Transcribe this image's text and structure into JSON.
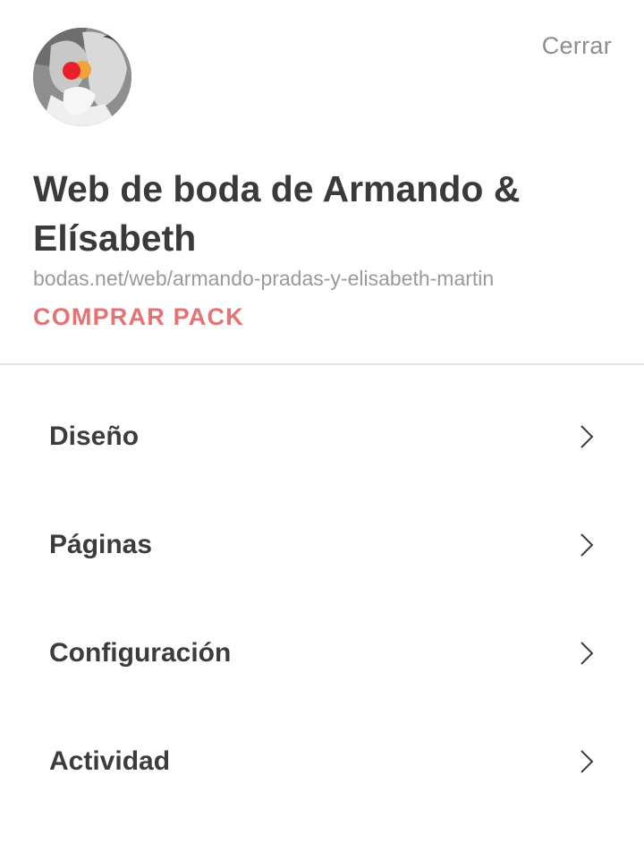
{
  "header": {
    "close_label": "Cerrar"
  },
  "site": {
    "title": "Web de boda de Armando & Elísabeth",
    "url": "bodas.net/web/armando-pradas-y-elisabeth-martin",
    "buy_label": "COMPRAR PACK"
  },
  "menu": {
    "items": [
      {
        "label": "Diseño",
        "icon": "chevron-right-icon"
      },
      {
        "label": "Páginas",
        "icon": "chevron-right-icon"
      },
      {
        "label": "Configuración",
        "icon": "chevron-right-icon"
      },
      {
        "label": "Actividad",
        "icon": "chevron-right-icon"
      }
    ]
  },
  "colors": {
    "accent": "#e57373",
    "text": "#3c3c3c",
    "muted": "#9a9a9a",
    "divider": "#e2e2e2"
  }
}
